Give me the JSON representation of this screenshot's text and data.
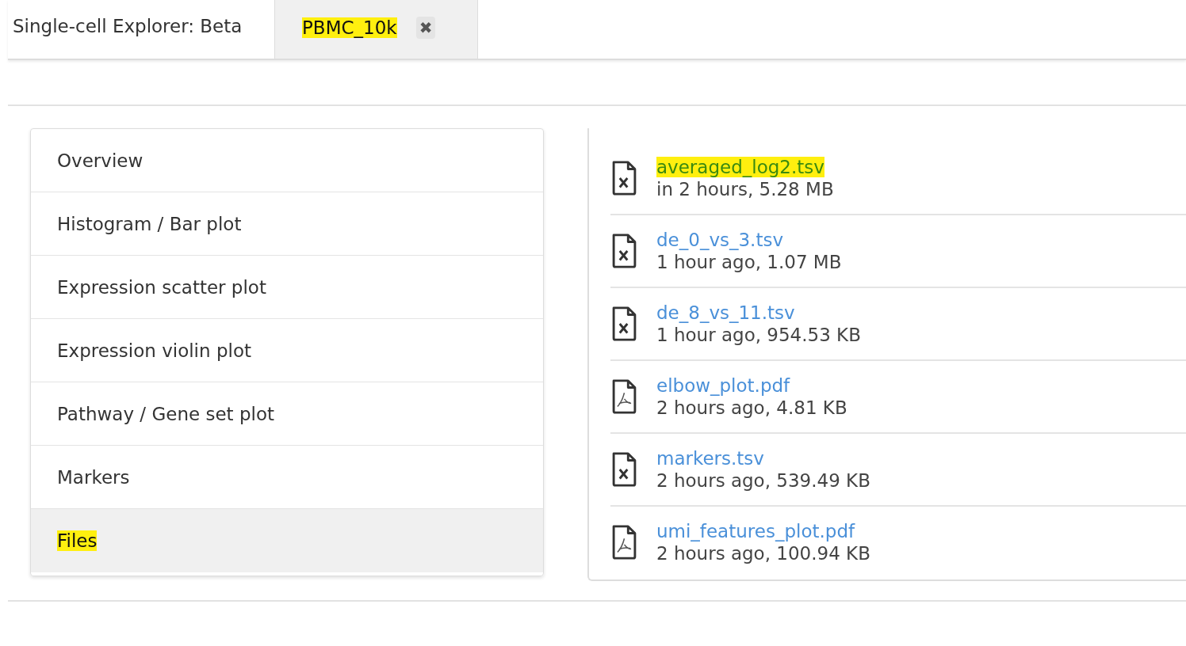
{
  "app_title": "Single-cell Explorer: Beta",
  "tabs": [
    {
      "label": "PBMC_10k",
      "selected": true,
      "highlighted": true,
      "close": "✖"
    }
  ],
  "menu": [
    {
      "label": "Overview",
      "selected": false,
      "highlighted": false
    },
    {
      "label": "Histogram / Bar plot",
      "selected": false,
      "highlighted": false
    },
    {
      "label": "Expression scatter plot",
      "selected": false,
      "highlighted": false
    },
    {
      "label": "Expression violin plot",
      "selected": false,
      "highlighted": false
    },
    {
      "label": "Pathway / Gene set plot",
      "selected": false,
      "highlighted": false
    },
    {
      "label": "Markers",
      "selected": false,
      "highlighted": false
    },
    {
      "label": "Files",
      "selected": true,
      "highlighted": true
    }
  ],
  "files": [
    {
      "name": "averaged_log2.tsv",
      "info": "in 2 hours, 5.28 MB",
      "kind": "table",
      "highlighted": true
    },
    {
      "name": "de_0_vs_3.tsv",
      "info": "1 hour ago, 1.07 MB",
      "kind": "table",
      "highlighted": false
    },
    {
      "name": "de_8_vs_11.tsv",
      "info": "1 hour ago, 954.53 KB",
      "kind": "table",
      "highlighted": false
    },
    {
      "name": "elbow_plot.pdf",
      "info": "2 hours ago, 4.81 KB",
      "kind": "pdf",
      "highlighted": false
    },
    {
      "name": "markers.tsv",
      "info": "2 hours ago, 539.49 KB",
      "kind": "table",
      "highlighted": false
    },
    {
      "name": "umi_features_plot.pdf",
      "info": "2 hours ago, 100.94 KB",
      "kind": "pdf",
      "highlighted": false
    }
  ]
}
